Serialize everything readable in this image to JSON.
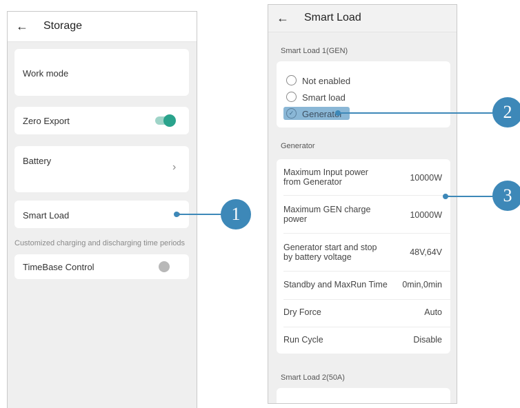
{
  "left_screen": {
    "title": "Storage",
    "back_icon": "←",
    "items": {
      "work_mode": "Work mode",
      "zero_export": "Zero Export",
      "battery": "Battery",
      "smart_load": "Smart Load",
      "timebase": "TimeBase Control"
    },
    "zero_export_on": true,
    "timebase_on": false,
    "hint": "Customized charging and discharging time periods",
    "chevron": "›"
  },
  "right_screen": {
    "title": "Smart Load",
    "back_icon": "←",
    "section1": "Smart Load 1(GEN)",
    "options": [
      "Not enabled",
      "Smart load",
      "Generator"
    ],
    "selected_option": "Generator",
    "section2": "Generator",
    "rows": [
      {
        "label": "Maximum Input power from Generator",
        "value": "10000W"
      },
      {
        "label": "Maximum GEN charge power",
        "value": "10000W"
      },
      {
        "label": "Generator start and stop by battery voltage",
        "value": "48V,64V"
      },
      {
        "label": "Standby and MaxRun Time",
        "value": "0min,0min"
      },
      {
        "label": "Dry Force",
        "value": "Auto"
      },
      {
        "label": "Run Cycle",
        "value": "Disable"
      }
    ],
    "section3": "Smart Load 2(50A)"
  },
  "callouts": [
    "1",
    "2",
    "3"
  ],
  "colors": {
    "accent": "#3d88b8",
    "toggle_on": "#2aa38c",
    "selected": "#8ab7d6"
  }
}
